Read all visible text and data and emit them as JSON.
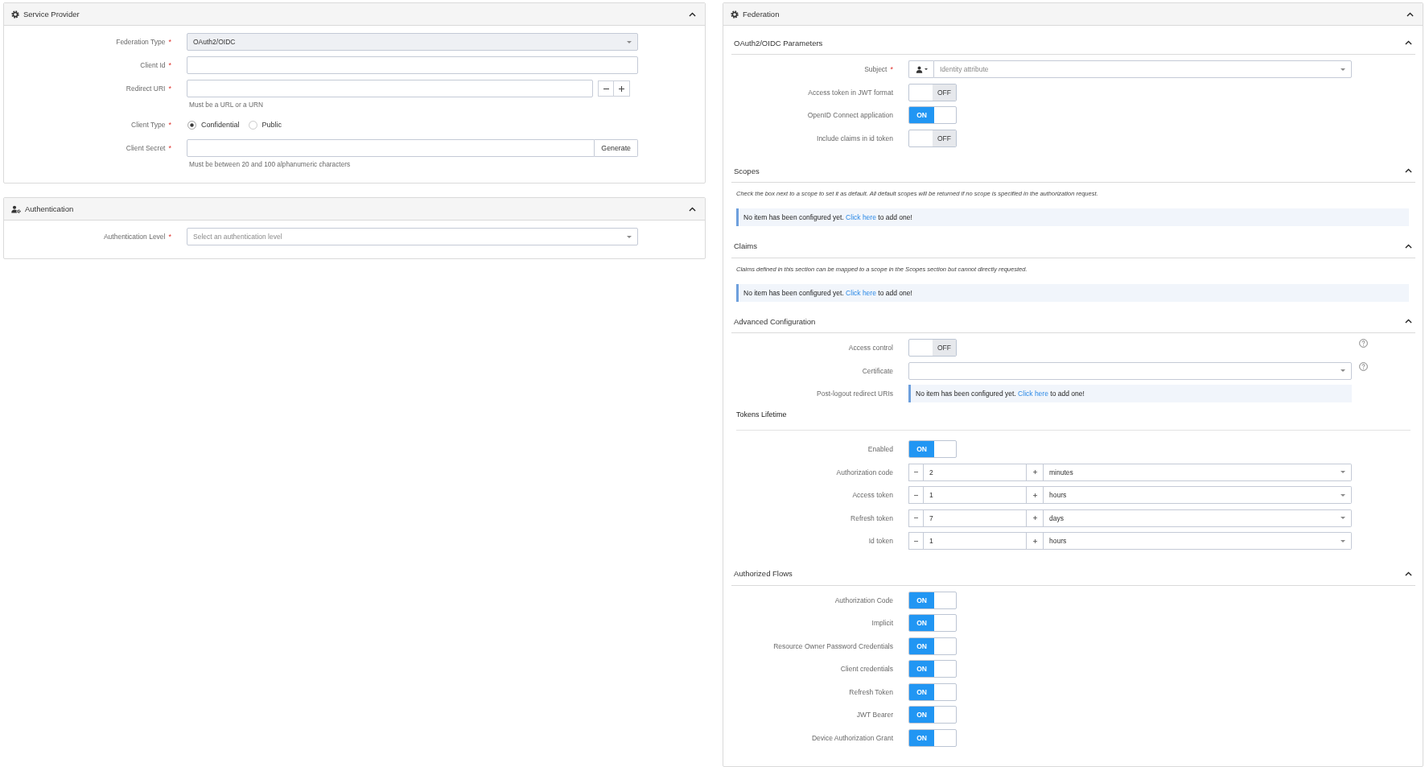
{
  "service_provider": {
    "title": "Service Provider",
    "expanded": true,
    "fields": [
      {
        "kind": "select",
        "label": "Federation Type",
        "required_mark": "*",
        "value": "OAuth2/OIDC",
        "disabled": true
      },
      {
        "kind": "text",
        "label": "Client Id",
        "required_mark": "*"
      },
      {
        "kind": "list_input",
        "label": "Redirect URI",
        "required_mark": "*",
        "hint": "Must be a URL or a URN"
      },
      {
        "kind": "radio",
        "label": "Client Type",
        "required_mark": "*",
        "options": [
          {
            "label": "Confidential",
            "selected": true
          },
          {
            "label": "Public",
            "selected": false
          }
        ]
      },
      {
        "kind": "secret",
        "label": "Client Secret",
        "required_mark": "*",
        "button": "Generate",
        "hint": "Must be between 20 and 100 alphanumeric characters"
      }
    ]
  },
  "authentication": {
    "title": "Authentication",
    "expanded": true,
    "fields": [
      {
        "kind": "select",
        "label": "Authentication Level",
        "required_mark": "*",
        "placeholder": "Select an authentication level",
        "disabled": false
      }
    ]
  },
  "federation": {
    "title": "Federation",
    "expanded": true,
    "sections": [
      {
        "title": "OAuth2/OIDC Parameters",
        "expanded": true,
        "rows": [
          {
            "kind": "attribute_select",
            "label": "Subject",
            "required_mark": "*",
            "placeholder": "Identity attribute"
          },
          {
            "kind": "toggle",
            "label": "Access token in JWT format",
            "on": false,
            "state_text": "OFF"
          },
          {
            "kind": "toggle",
            "label": "OpenID Connect application",
            "on": true,
            "state_text": "ON"
          },
          {
            "kind": "toggle",
            "label": "Include claims in id token",
            "on": false,
            "state_text": "OFF"
          }
        ]
      },
      {
        "title": "Scopes",
        "expanded": true,
        "description": "Check the box next to a scope to set it as default. All default scopes will be returned if no scope is specified in the authorization request.",
        "rows": [
          {
            "kind": "notice",
            "text": "No item has been configured yet.",
            "link": "Click here",
            "text_after": "to add one!"
          }
        ]
      },
      {
        "title": "Claims",
        "expanded": true,
        "description": "Claims defined in this section can be mapped to a scope in the Scopes section but cannot directly requested.",
        "rows": [
          {
            "kind": "notice",
            "text": "No item has been configured yet.",
            "link": "Click here",
            "text_after": "to add one!"
          }
        ]
      },
      {
        "title": "Advanced Configuration",
        "expanded": true,
        "rows": [
          {
            "kind": "toggle",
            "label": "Access control",
            "on": false,
            "state_text": "OFF",
            "help": true
          },
          {
            "kind": "select",
            "label": "Certificate",
            "help": true
          },
          {
            "kind": "notice",
            "label": "Post-logout redirect URIs",
            "text": "No item has been configured yet.",
            "link": "Click here",
            "text_after": "to add one!"
          },
          {
            "kind": "heading",
            "text": "Tokens Lifetime"
          },
          {
            "kind": "toggle",
            "label": "Enabled",
            "on": true,
            "state_text": "ON"
          },
          {
            "kind": "duration",
            "label": "Authorization code",
            "value": "2",
            "unit": "minutes"
          },
          {
            "kind": "duration",
            "label": "Access token",
            "value": "1",
            "unit": "hours"
          },
          {
            "kind": "duration",
            "label": "Refresh token",
            "value": "7",
            "unit": "days"
          },
          {
            "kind": "duration",
            "label": "Id token",
            "value": "1",
            "unit": "hours"
          }
        ]
      },
      {
        "title": "Authorized Flows",
        "expanded": true,
        "rows": [
          {
            "kind": "toggle",
            "label": "Authorization Code",
            "on": true,
            "state_text": "ON"
          },
          {
            "kind": "toggle",
            "label": "Implicit",
            "on": true,
            "state_text": "ON"
          },
          {
            "kind": "toggle",
            "label": "Resource Owner Password Credentials",
            "on": true,
            "state_text": "ON"
          },
          {
            "kind": "toggle",
            "label": "Client credentials",
            "on": true,
            "state_text": "ON"
          },
          {
            "kind": "toggle",
            "label": "Refresh Token",
            "on": true,
            "state_text": "ON"
          },
          {
            "kind": "toggle",
            "label": "JWT Bearer",
            "on": true,
            "state_text": "ON"
          },
          {
            "kind": "toggle",
            "label": "Device Authorization Grant",
            "on": true,
            "state_text": "ON"
          }
        ]
      }
    ]
  }
}
